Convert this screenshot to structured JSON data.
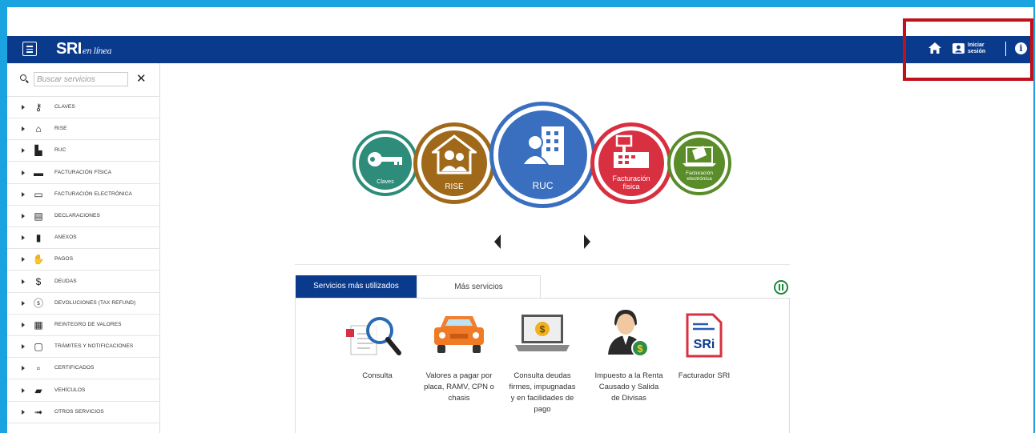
{
  "topbar": {
    "logo_main": "SRI",
    "logo_sub": "en línea",
    "login_line1": "Iniciar",
    "login_line2": "sesión",
    "info_glyph": "i"
  },
  "sidebar": {
    "search_placeholder": "Buscar servicios",
    "clear_glyph": "✕",
    "items": [
      {
        "label": "CLAVES",
        "icon": "key-icon"
      },
      {
        "label": "RISE",
        "icon": "house-icon"
      },
      {
        "label": "RUC",
        "icon": "building-icon"
      },
      {
        "label": "FACTURACIÓN FÍSICA",
        "icon": "cash-register-icon"
      },
      {
        "label": "FACTURACIÓN ELECTRÓNICA",
        "icon": "laptop-icon"
      },
      {
        "label": "DECLARACIONES",
        "icon": "document-icon"
      },
      {
        "label": "ANEXOS",
        "icon": "file-icon"
      },
      {
        "label": "PAGOS",
        "icon": "payment-hand-icon"
      },
      {
        "label": "DEUDAS",
        "icon": "dollar-icon"
      },
      {
        "label": "DEVOLUCIONES (TAX REFUND)",
        "icon": "dollar-circle-icon"
      },
      {
        "label": "REINTEGRO DE VALORES",
        "icon": "refund-icon"
      },
      {
        "label": "TRÁMITES Y NOTIFICACIONES",
        "icon": "notification-icon"
      },
      {
        "label": "CERTIFICADOS",
        "icon": "certificate-icon"
      },
      {
        "label": "VEHÍCULOS",
        "icon": "car-icon"
      },
      {
        "label": "OTROS SERVICIOS",
        "icon": "arrow-services-icon"
      }
    ]
  },
  "carousel": {
    "items": [
      {
        "label": "Claves",
        "color": "#2e8c7a"
      },
      {
        "label": "RISE",
        "color": "#a0691a"
      },
      {
        "label": "RUC",
        "color": "#3a6fc0"
      },
      {
        "label_line1": "Facturación",
        "label_line2": "física",
        "color": "#d83040"
      },
      {
        "label_line1": "Facturación",
        "label_line2": "electrónica",
        "color": "#5a8c2a"
      }
    ]
  },
  "tabs": {
    "active": "Servicios más utilizados",
    "inactive": "Más servicios"
  },
  "services": [
    {
      "title_lines": [
        "Consulta"
      ],
      "icon": "magnifier-document-icon"
    },
    {
      "title_lines": [
        "Valores a pagar por",
        "placa, RAMV, CPN o",
        "chasis"
      ],
      "icon": "car-icon"
    },
    {
      "title_lines": [
        "Consulta deudas",
        "firmes, impugnadas",
        "y en facilidades de",
        "pago"
      ],
      "icon": "laptop-dollar-icon"
    },
    {
      "title_lines": [
        "Impuesto a la Renta",
        "Causado y Salida",
        "de Divisas"
      ],
      "icon": "businessman-icon"
    },
    {
      "title_lines": [
        "Facturador SRI"
      ],
      "icon": "sri-invoice-icon"
    }
  ],
  "colors": {
    "brand_blue": "#0a3a8c",
    "frame_cyan": "#1aa3e0",
    "highlight_red": "#c0111b",
    "pause_green": "#1a8a3a"
  }
}
